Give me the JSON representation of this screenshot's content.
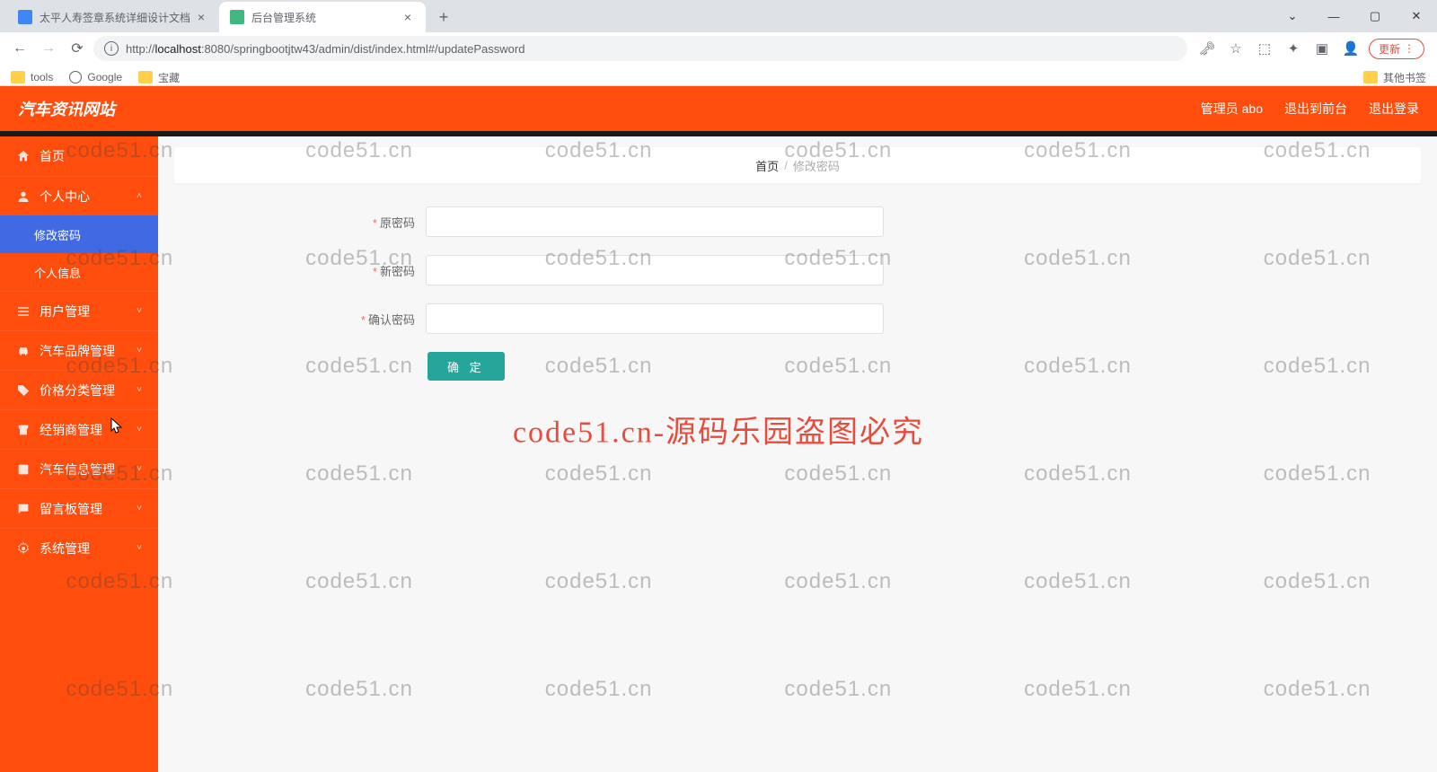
{
  "browser": {
    "tabs": [
      {
        "title": "太平人寿签章系统详细设计文档",
        "active": false
      },
      {
        "title": "后台管理系统",
        "active": true
      }
    ],
    "window_controls": {
      "minimize": "—",
      "maximize": "▢",
      "close": "✕",
      "dropdown": "⌄"
    },
    "nav": {
      "back": "←",
      "forward": "→",
      "reload": "⟳"
    },
    "url": {
      "info_icon": "ⓘ",
      "prefix": "http://",
      "host": "localhost",
      "rest": ":8080/springbootjtw43/admin/dist/index.html#/updatePassword"
    },
    "addr_icons": [
      "🗝",
      "☆",
      "⬚",
      "✦",
      "▣",
      "👤"
    ],
    "update_btn": "更新",
    "bookmarks": {
      "tools": "tools",
      "google": "Google",
      "treasure": "宝藏",
      "other": "其他书签"
    }
  },
  "header": {
    "logo": "汽车资讯网站",
    "links": {
      "admin": "管理员 abo",
      "front": "退出到前台",
      "logout": "退出登录"
    }
  },
  "sidebar": {
    "home": "首页",
    "personal": "个人中心",
    "sub_password": "修改密码",
    "sub_profile": "个人信息",
    "user_mgmt": "用户管理",
    "brand_mgmt": "汽车品牌管理",
    "price_mgmt": "价格分类管理",
    "dealer_mgmt": "经销商管理",
    "carinfo_mgmt": "汽车信息管理",
    "board_mgmt": "留言板管理",
    "sys_mgmt": "系统管理"
  },
  "breadcrumb": {
    "home": "首页",
    "current": "修改密码"
  },
  "form": {
    "old_pwd": "原密码",
    "new_pwd": "新密码",
    "confirm_pwd": "确认密码",
    "submit": "确 定"
  },
  "watermark": {
    "repeat": "code51.cn",
    "center": "code51.cn-源码乐园盗图必究"
  }
}
